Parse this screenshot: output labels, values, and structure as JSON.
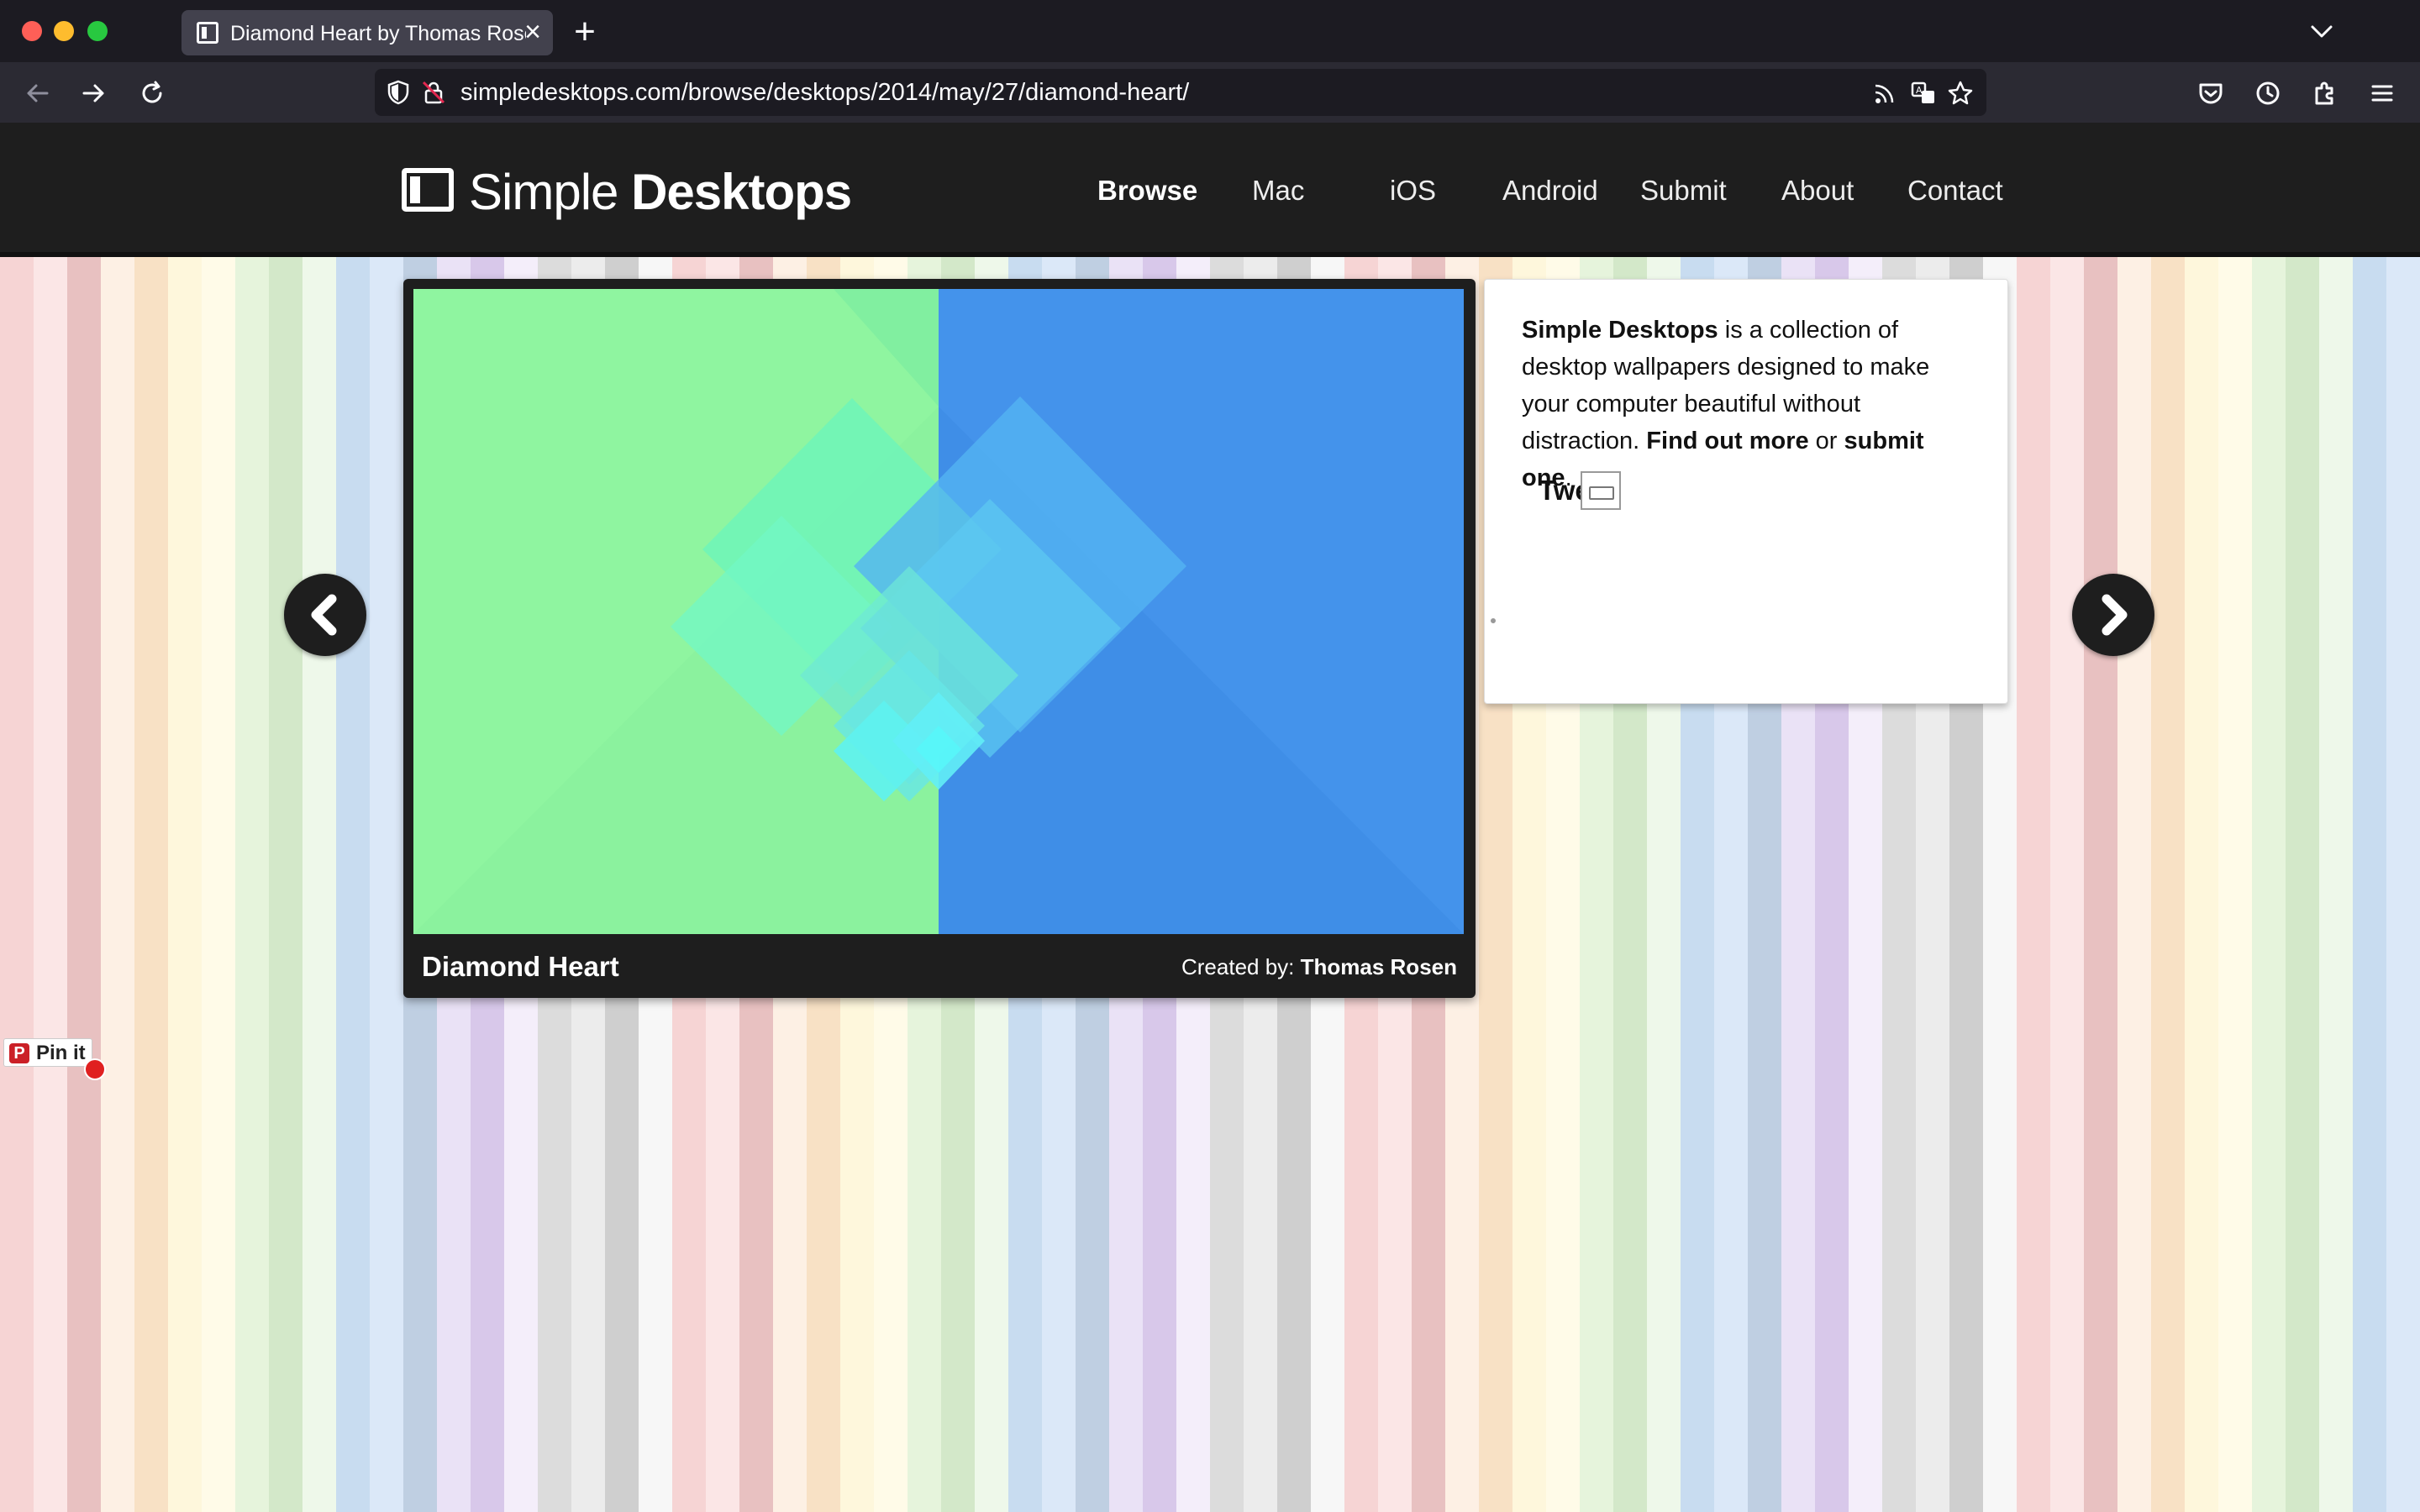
{
  "browser": {
    "tab_title": "Diamond Heart by Thomas Rose",
    "url": "simpledesktops.com/browse/desktops/2014/may/27/diamond-heart/"
  },
  "site": {
    "logo_light": "Simple",
    "logo_bold": "Desktops",
    "nav": [
      "Browse",
      "Mac",
      "iOS",
      "Android",
      "Submit",
      "About",
      "Contact"
    ],
    "active_nav": "Browse"
  },
  "wallpaper": {
    "title": "Diamond Heart",
    "credit_label": "Created by:",
    "author": "Thomas Rosen",
    "colors": {
      "left": "#8ff5a0",
      "right": "#4393ea",
      "accent": "#5ff5e8"
    }
  },
  "info": {
    "brand": "Simple Desktops",
    "text1": " is a collection of desktop wallpapers designed to make your computer beautiful without distraction. ",
    "find_out_more": "Find out more",
    "or": " or ",
    "submit_one": "submit one",
    "period": ".",
    "tweet": "Twe"
  },
  "pinit": {
    "label": "Pin it",
    "logo": "P"
  }
}
